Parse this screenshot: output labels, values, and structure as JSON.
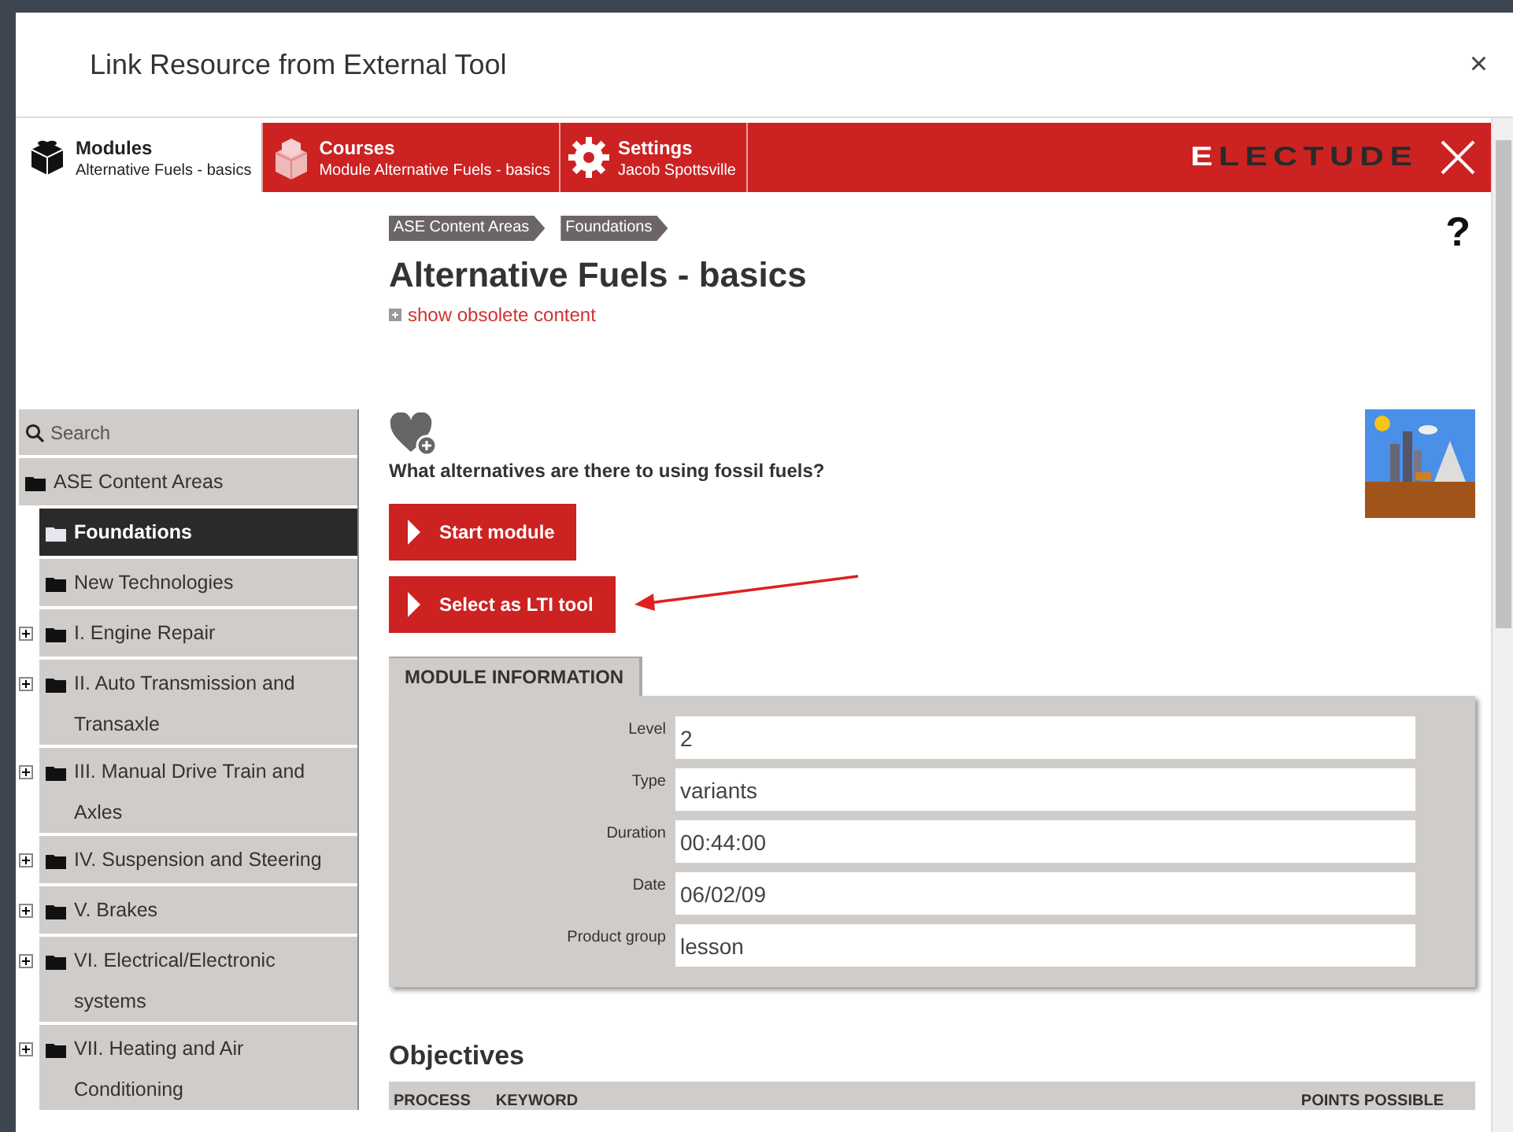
{
  "dialog": {
    "title": "Link Resource from External Tool",
    "close": "×"
  },
  "nav": {
    "tabs": [
      {
        "kind": "modules",
        "title": "Modules",
        "subtitle": "Alternative Fuels - basics",
        "selected": true
      },
      {
        "kind": "courses",
        "title": "Courses",
        "subtitle": "Module Alternative Fuels - basics",
        "selected": false
      },
      {
        "kind": "settings",
        "title": "Settings",
        "subtitle": "Jacob Spottsville",
        "selected": false
      }
    ],
    "logo": "ELECTUDE"
  },
  "help": "?",
  "breadcrumbs": [
    "ASE Content Areas",
    "Foundations"
  ],
  "page_title": "Alternative Fuels - basics",
  "obsolete_link": "show obsolete content",
  "sidebar": {
    "search": {
      "placeholder": "Search"
    },
    "tree": [
      {
        "label": "ASE Content Areas",
        "selected": false,
        "children": [
          {
            "label": "Foundations",
            "selected": true
          },
          {
            "label": "New Technologies",
            "selected": false
          },
          {
            "label": "I. Engine Repair",
            "selected": false,
            "expanded": false
          },
          {
            "label": "II. Auto Transmission and Transaxle",
            "selected": false,
            "expanded": false
          },
          {
            "label": "III. Manual Drive Train and Axles",
            "selected": false,
            "expanded": false
          },
          {
            "label": "IV. Suspension and Steering",
            "selected": false,
            "expanded": false
          },
          {
            "label": "V. Brakes",
            "selected": false,
            "expanded": false
          },
          {
            "label": "VI. Electrical/Electronic systems",
            "selected": false,
            "expanded": false
          },
          {
            "label": "VII. Heating and Air Conditioning",
            "selected": false,
            "expanded": false
          }
        ]
      }
    ]
  },
  "module": {
    "question": "What alternatives are there to using fossil fuels?",
    "buttons": [
      {
        "label": "Start module"
      },
      {
        "label": "Select as LTI tool"
      }
    ]
  },
  "info": {
    "tab": "MODULE INFORMATION",
    "fields": [
      {
        "label": "Level",
        "value": "2"
      },
      {
        "label": "Type",
        "value": "variants"
      },
      {
        "label": "Duration",
        "value": "00:44:00"
      },
      {
        "label": "Date",
        "value": "06/02/09"
      },
      {
        "label": "Product group",
        "value": "lesson"
      }
    ]
  },
  "objectives": {
    "heading": "Objectives",
    "columns": [
      "PROCESS",
      "KEYWORD",
      "POINTS POSSIBLE"
    ]
  }
}
